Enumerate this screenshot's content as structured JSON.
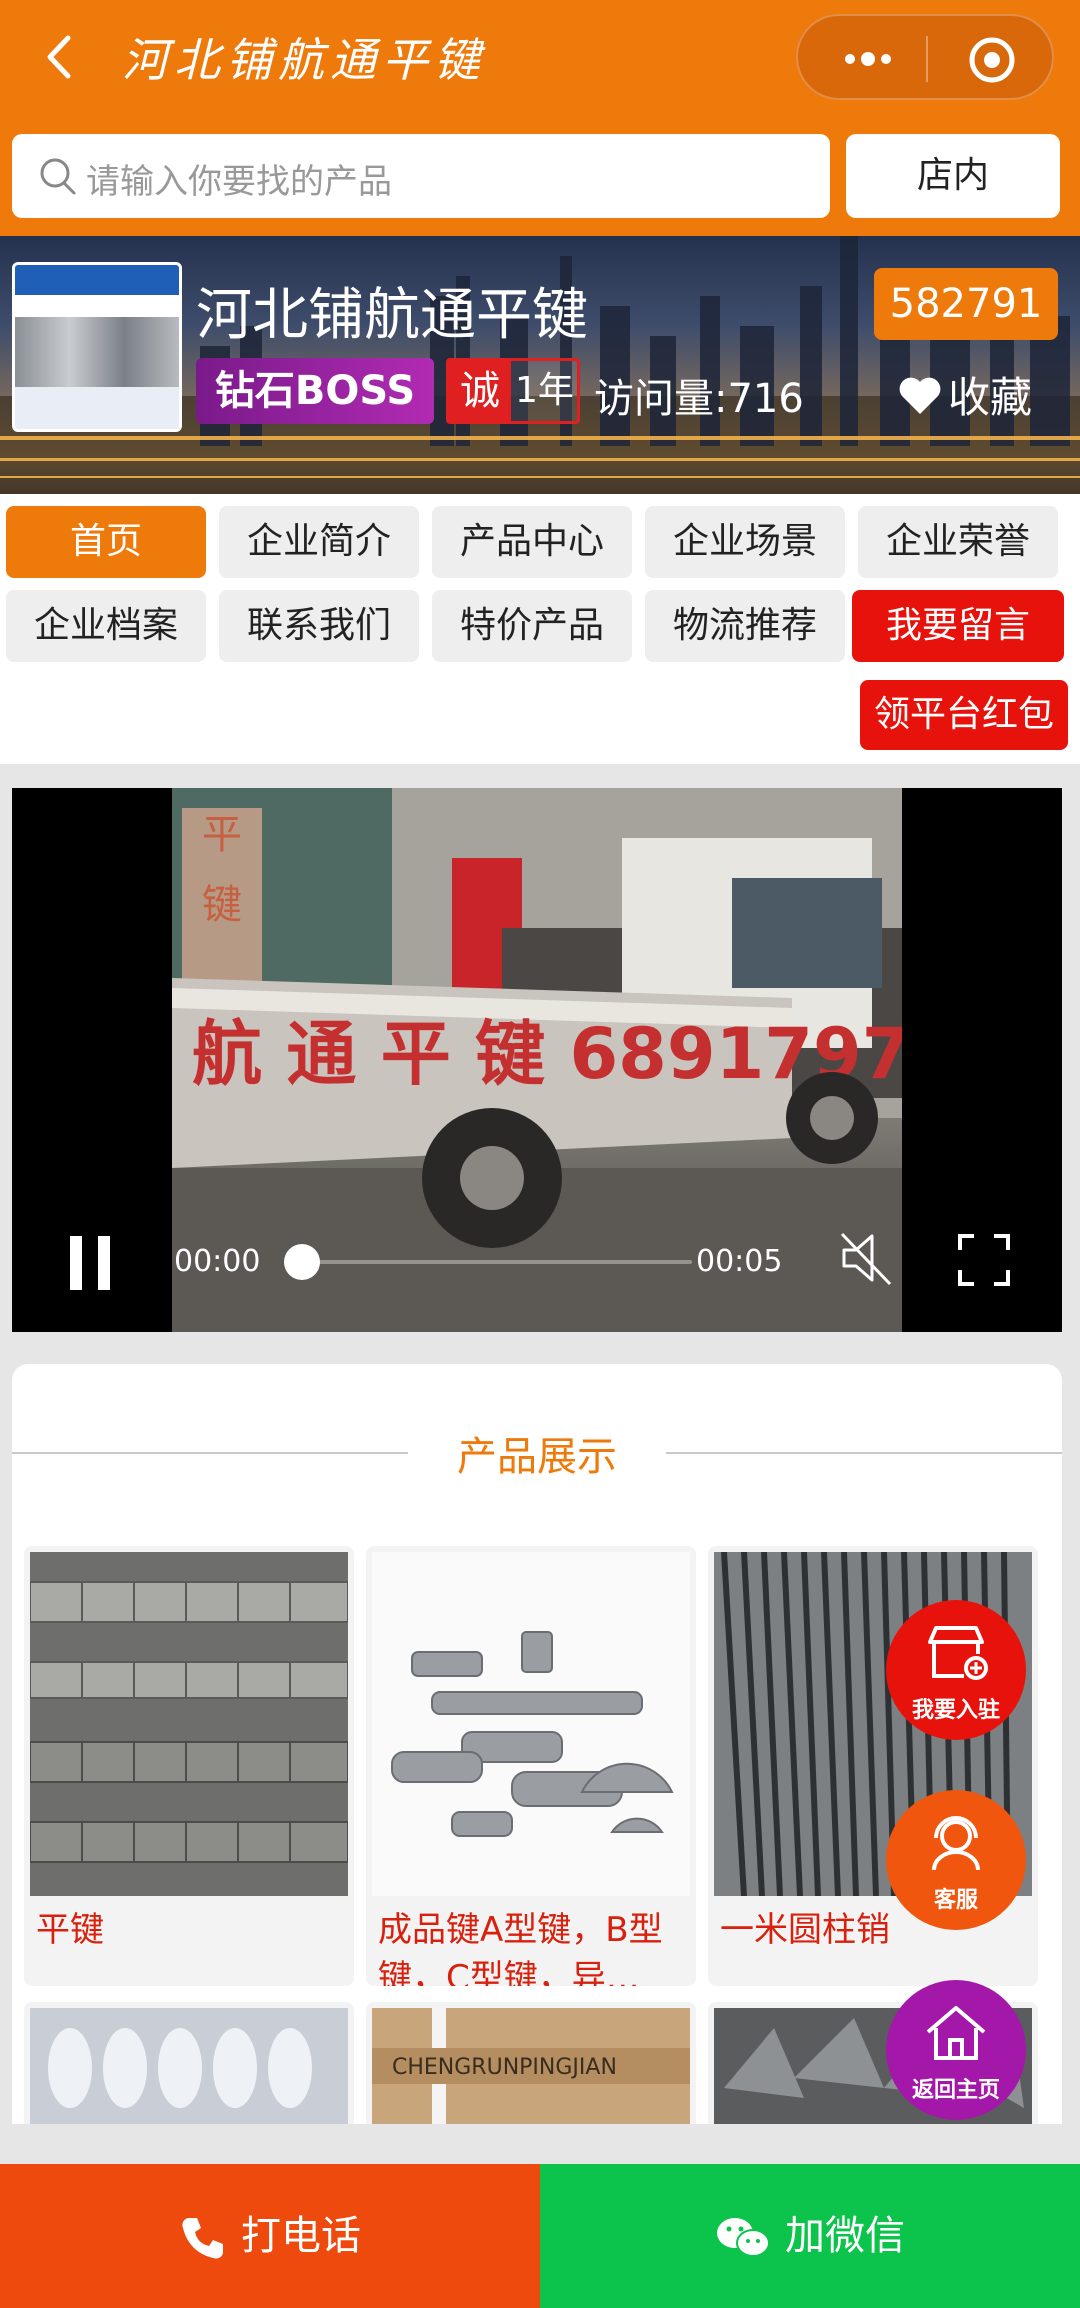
{
  "header": {
    "title": "河北铺航通平键",
    "search_placeholder": "请输入你要找的产品",
    "scope_button": "店内"
  },
  "shop": {
    "name": "河北铺航通平键",
    "id": "582791",
    "level_badge": "钻石BOSS",
    "cheng_char": "诚",
    "cheng_years": "1年",
    "visits": "访问量:716",
    "favorite": "收藏"
  },
  "nav": {
    "items": [
      {
        "label": "首页",
        "state": "active"
      },
      {
        "label": "企业简介"
      },
      {
        "label": "产品中心"
      },
      {
        "label": "企业场景"
      },
      {
        "label": "企业荣誉"
      },
      {
        "label": "企业档案"
      },
      {
        "label": "联系我们"
      },
      {
        "label": "特价产品"
      },
      {
        "label": "物流推荐"
      },
      {
        "label": "我要留言",
        "state": "highlight"
      },
      {
        "label": "领平台红包",
        "state": "highlight"
      }
    ]
  },
  "video": {
    "current_time": "00:00",
    "duration": "00:05",
    "truck_text": "航 通 平 键  6891797",
    "wall_text": "平键"
  },
  "products": {
    "section_title": "产品展示",
    "items": [
      {
        "name": "平键"
      },
      {
        "name": "成品键A型键，B型键，C型键，异…"
      },
      {
        "name": "一米圆柱销"
      },
      {
        "name": ""
      },
      {
        "name": ""
      },
      {
        "name": ""
      }
    ]
  },
  "floating": {
    "join": "我要入驻",
    "service": "客服",
    "home": "返回主页"
  },
  "bottom": {
    "call": "打电话",
    "wechat": "加微信"
  },
  "colors": {
    "brand_orange": "#ee7a0c",
    "highlight_red": "#e8120c",
    "call_orange": "#ee4a0e",
    "wechat_green": "#0cc34c",
    "home_purple": "#a318a8"
  }
}
